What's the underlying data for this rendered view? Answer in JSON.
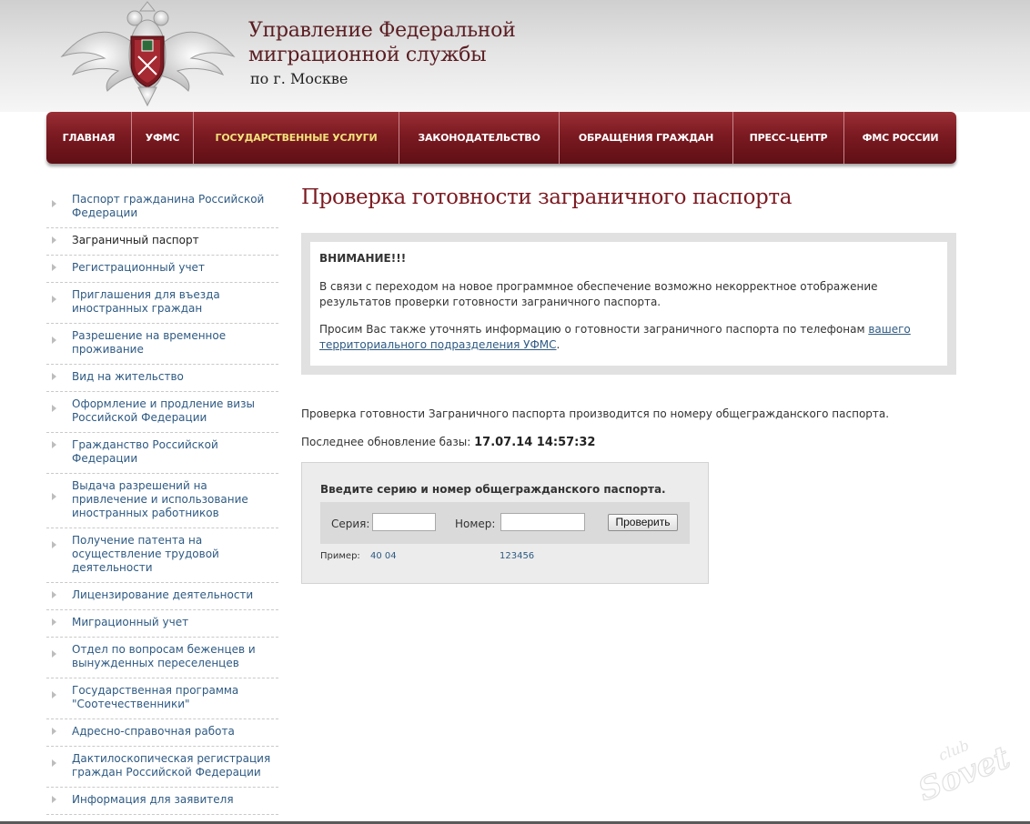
{
  "header": {
    "title_line1": "Управление Федеральной",
    "title_line2": "миграционной службы",
    "subtitle": "по г. Москве"
  },
  "nav": [
    {
      "label": "ГЛАВНАЯ"
    },
    {
      "label": "УФМС"
    },
    {
      "label": "ГОСУДАРСТВЕННЫЕ УСЛУГИ",
      "active": true
    },
    {
      "label": "ЗАКОНОДАТЕЛЬСТВО"
    },
    {
      "label": "ОБРАЩЕНИЯ ГРАЖДАН"
    },
    {
      "label": "ПРЕСС-ЦЕНТР"
    },
    {
      "label": "ФМС РОССИИ"
    }
  ],
  "sidebar": [
    {
      "label": "Паспорт гражданина Российской Федерации"
    },
    {
      "label": "Заграничный паспорт",
      "current": true
    },
    {
      "label": "Регистрационный учет"
    },
    {
      "label": "Приглашения для въезда иностранных граждан"
    },
    {
      "label": "Разрешение на временное проживание"
    },
    {
      "label": "Вид на жительство"
    },
    {
      "label": "Оформление и продление визы Российской Федерации"
    },
    {
      "label": "Гражданство Российской Федерации"
    },
    {
      "label": "Выдача разрешений на привлечение и использование иностранных работников"
    },
    {
      "label": "Получение патента на осуществление трудовой деятельности"
    },
    {
      "label": "Лицензирование деятельности"
    },
    {
      "label": "Миграционный учет"
    },
    {
      "label": "Отдел по вопросам беженцев и вынужденных переселенцев"
    },
    {
      "label": "Государственная программа \"Соотечественники\""
    },
    {
      "label": "Адресно-справочная работа"
    },
    {
      "label": "Дактилоскопическая регистрация граждан Российской Федерации"
    },
    {
      "label": "Информация для заявителя"
    }
  ],
  "main": {
    "title": "Проверка готовности заграничного паспорта",
    "notice": {
      "heading": "ВНИМАНИЕ!!!",
      "paragraph1": "В связи с переходом на новое программное обеспечение возможно некорректное отображение результатов проверки готовности заграничного паспорта.",
      "paragraph2_text": "Просим Вас также уточнять информацию о готовности заграничного паспорта по телефонам ",
      "paragraph2_link": "вашего территориального подразделения УФМС",
      "paragraph2_end": "."
    },
    "info_text": "Проверка готовности Заграничного паспорта производится по номеру общегражданского паспорта.",
    "last_update_label": "Последнее обновление базы: ",
    "last_update_value": "17.07.14 14:57:32"
  },
  "form": {
    "title": "Введите серию и номер общегражданского паспорта.",
    "series_label": "Серия:",
    "series_value": "",
    "number_label": "Номер:",
    "number_value": "",
    "submit_label": "Проверить",
    "example_label": "Пример:",
    "example_series": "40 04",
    "example_number": "123456"
  },
  "colors": {
    "nav_bg": "#7b1a21",
    "nav_active": "#f2e07a",
    "title": "#7b1a21",
    "link": "#2e5a83"
  }
}
